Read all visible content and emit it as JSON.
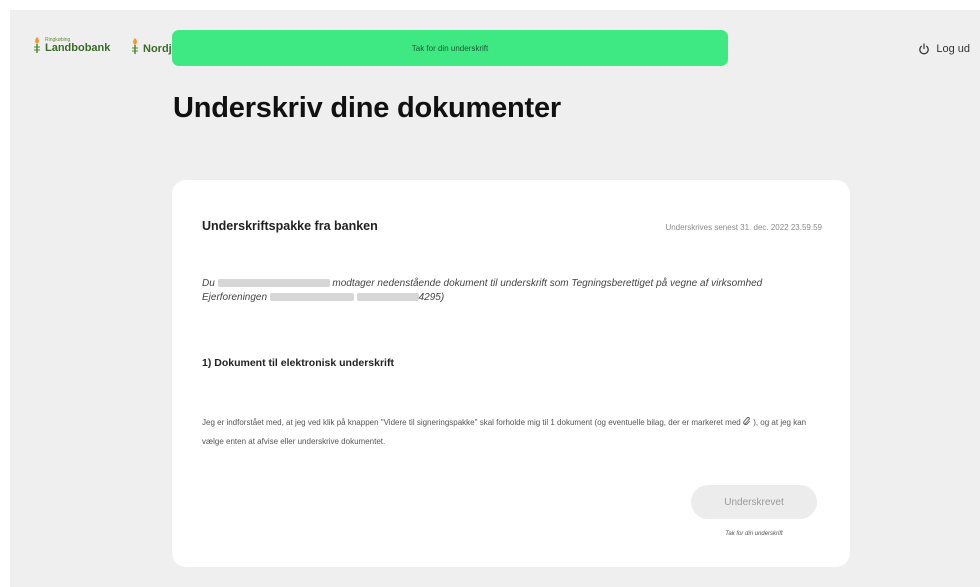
{
  "header": {
    "logo1_small": "Ringkøbing",
    "logo1_big": "Landbobank",
    "logo2": "Nordjy",
    "toast": "Tak for din underskrift",
    "logout": "Log ud"
  },
  "page": {
    "title": "Underskriv dine dokumenter"
  },
  "card": {
    "title": "Underskriftspakke fra banken",
    "deadline": "Underskrives senest 31. dec. 2022 23.59.59",
    "intro_part1": "Du",
    "intro_part2": "modtager nedenstående dokument til underskrift som Tegningsberettiget på vegne af virksomhed Ejerforeningen",
    "intro_part3": "4295)",
    "section_heading": "1) Dokument til elektronisk underskrift",
    "consent_part1": "Jeg er indforstået med, at jeg ved klik på knappen \"Videre til signeringspakke\" skal forholde mig til 1 dokument (og eventuelle bilag, der er markeret med",
    "consent_part2": "), og at jeg kan vælge enten at afvise eller underskrive dokumentet.",
    "signed_button": "Underskrevet",
    "thanks": "Tak for din underskrift"
  },
  "colors": {
    "toast": "#3ee882",
    "background": "#efefef",
    "card": "#ffffff",
    "button_disabled": "#ececec"
  },
  "icons": {
    "logout": "power-icon",
    "attachment": "paperclip-icon",
    "logo": "flame-logo-icon"
  }
}
